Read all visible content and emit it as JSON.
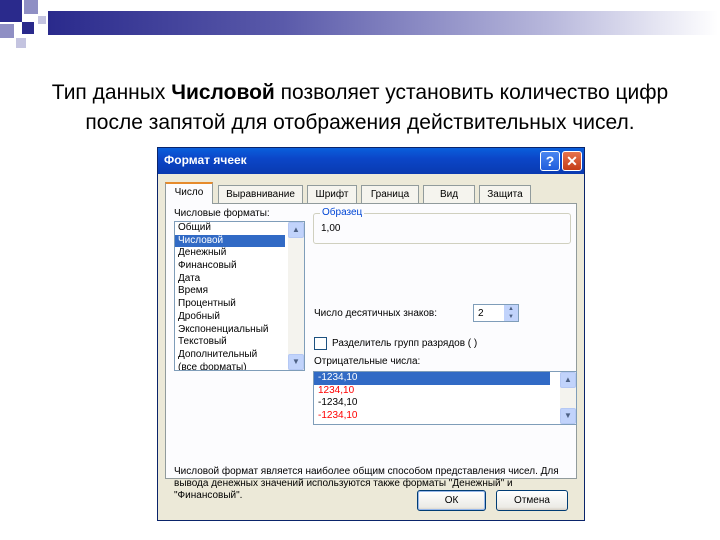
{
  "slide": {
    "line1_prefix": "Тип данных ",
    "line1_bold": "Числовой",
    "line1_suffix": " позволяет установить количество цифр",
    "line2": "после запятой для отображения действительных чисел."
  },
  "colors": {
    "accent_topbar": "#2a2a8c",
    "selection": "#316ac5",
    "titlebar": "#0a46c8",
    "negative_red": "#ff0000"
  },
  "dialog": {
    "title": "Формат ячеек",
    "help_icon": "question-mark-icon",
    "close_icon": "close-x-icon",
    "tabs": [
      {
        "label": "Число",
        "active": true
      },
      {
        "label": "Выравнивание"
      },
      {
        "label": "Шрифт"
      },
      {
        "label": "Граница"
      },
      {
        "label": "Вид"
      },
      {
        "label": "Защита"
      }
    ],
    "formats_label": "Числовые форматы:",
    "formats": [
      "Общий",
      "Числовой",
      "Денежный",
      "Финансовый",
      "Дата",
      "Время",
      "Процентный",
      "Дробный",
      "Экспоненциальный",
      "Текстовый",
      "Дополнительный",
      "(все форматы)"
    ],
    "selected_format": "Числовой",
    "sample_label": "Образец",
    "sample_value": "1,00",
    "decimals_label": "Число десятичных знаков:",
    "decimals_value": "2",
    "separator_label": "Разделитель групп разрядов ( )",
    "separator_checked": false,
    "negative_label": "Отрицательные числа:",
    "negative_options": [
      "-1234,10",
      "1234,10",
      "-1234,10",
      "-1234,10"
    ],
    "description": "Числовой формат является наиболее общим способом представления чисел. Для вывода денежных значений используются также форматы \"Денежный\" и \"Финансовый\".",
    "ok_label": "ОК",
    "cancel_label": "Отмена"
  }
}
